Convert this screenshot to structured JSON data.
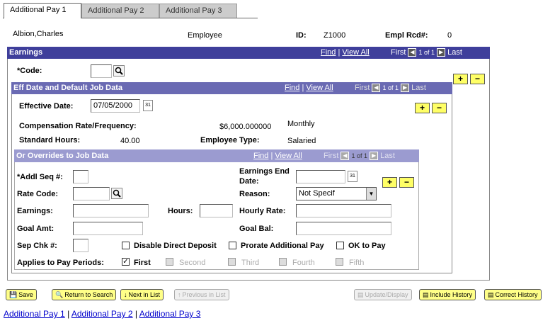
{
  "tabs": [
    "Additional Pay 1",
    "Additional Pay 2",
    "Additional Pay 3"
  ],
  "employee": {
    "name": "Albion,Charles",
    "type_label": "Employee",
    "id_label": "ID:",
    "id_value": "Z1000",
    "rcd_label": "Empl Rcd#:",
    "rcd_value": "0"
  },
  "earnings": {
    "title": "Earnings",
    "nav": {
      "find": "Find",
      "viewall": "View All",
      "first": "First",
      "count": "1 of 1",
      "last": "Last"
    },
    "code_label": "*Code:",
    "code_value": ""
  },
  "eff": {
    "title": "Eff Date and Default Job Data",
    "nav": {
      "find": "Find",
      "viewall": "View All",
      "first": "First",
      "count": "1 of 1",
      "last": "Last"
    },
    "date_label": "Effective Date:",
    "date_value": "07/05/2000",
    "comp_label": "Compensation Rate/Frequency:",
    "comp_value": "$6,000.000000",
    "comp_freq": "Monthly",
    "std_label": "Standard Hours:",
    "std_value": "40.00",
    "emptype_label": "Employee Type:",
    "emptype_value": "Salaried"
  },
  "overrides": {
    "title": "Or Overrides to Job Data",
    "nav": {
      "find": "Find",
      "viewall": "View All",
      "first": "First",
      "count": "1 of 1",
      "last": "Last"
    },
    "addl_seq_label": "*Addl Seq #:",
    "earn_end_label_1": "Earnings End",
    "earn_end_label_2": "Date:",
    "rate_code_label": "Rate Code:",
    "reason_label": "Reason:",
    "reason_value": "Not Specif",
    "earnings_label": "Earnings:",
    "hours_label": "Hours:",
    "hourly_rate_label": "Hourly Rate:",
    "goal_amt_label": "Goal Amt:",
    "goal_bal_label": "Goal Bal:",
    "sep_chk_label": "Sep Chk #:",
    "disable_dd": "Disable Direct Deposit",
    "prorate": "Prorate Additional Pay",
    "ok_to_pay": "OK to Pay",
    "applies_label": "Applies to Pay Periods:",
    "periods": [
      "First",
      "Second",
      "Third",
      "Fourth",
      "Fifth"
    ]
  },
  "buttons": {
    "save": "Save",
    "return": "Return to Search",
    "next": "Next in List",
    "prev": "Previous in List",
    "update": "Update/Display",
    "include": "Include History",
    "correct": "Correct History"
  },
  "bottom_links": [
    "Additional Pay 1",
    "Additional Pay 2",
    "Additional Pay 3"
  ],
  "colors": {
    "header": "#3f3f9b",
    "subheader": "#6a6ab3",
    "override_header": "#9b9bd0",
    "button_yellow": "#ffff88"
  }
}
